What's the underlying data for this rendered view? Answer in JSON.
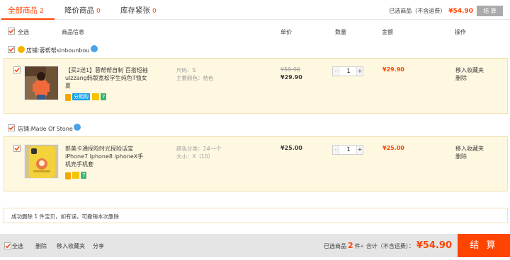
{
  "tabs": [
    {
      "label": "全部商品",
      "count": "2"
    },
    {
      "label": "降价商品",
      "count": "0"
    },
    {
      "label": "库存紧张",
      "count": "0"
    }
  ],
  "summary": {
    "label": "已选商品（不含运费）",
    "price": "¥54.90",
    "settle": "结 算"
  },
  "header": {
    "select_all": "全选",
    "product": "商品信息",
    "unit_price": "单价",
    "quantity": "数量",
    "amount": "金额",
    "operation": "操作"
  },
  "shops": [
    {
      "label": "店铺:",
      "name": "蓉帮帮sinbounbou",
      "item": {
        "title": "【买2送1】蓉帮帮自制 百搭短袖ulzzang韩版宽松学生纯色T恤女夏",
        "sku_line1": "尺码：S",
        "sku_line2": "主要颜色：桔色",
        "old_price": "¥59.90",
        "price": "¥29.90",
        "qty": "1",
        "sum": "¥29.90",
        "op1": "移入收藏夹",
        "op2": "删除",
        "badge": "分期购",
        "badge_number": "7"
      }
    },
    {
      "label": "店铺:",
      "name": "Made Of Stone",
      "item": {
        "title": "郎美卡通探险时光探险话宝iPhone7 iphone8 iphoneX手机壳手机套",
        "sku_line1": "颜色分类：2#一个",
        "sku_line2": "大小：X（10）",
        "price": "¥25.00",
        "qty": "1",
        "sum": "¥25.00",
        "op1": "移入收藏夹",
        "op2": "删除",
        "badge_number": "7"
      }
    }
  ],
  "notice": "成功删除 1 件宝贝，如有误，可撤销本次删除",
  "bottom": {
    "select_all": "全选",
    "delete": "删除",
    "favorite": "移入收藏夹",
    "share": "分享",
    "selected_prefix": "已选商品",
    "selected_count": "2",
    "selected_unit": "件",
    "total_label": "合计（不含运费）：",
    "total_price": "¥54.90",
    "settle": "结 算"
  },
  "colors": {
    "accent": "#ff4400",
    "item_bg": "#fff8e1",
    "bottom_bg": "#e5e5e5"
  }
}
